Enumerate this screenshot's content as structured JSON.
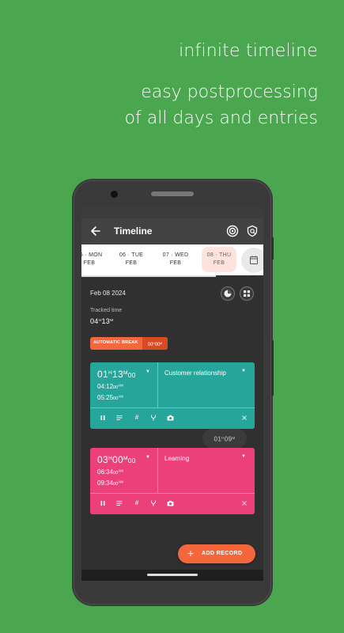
{
  "promo": {
    "title": "infinite timeline",
    "subtitle_line1": "easy postprocessing",
    "subtitle_line2": "of all days and entries"
  },
  "appbar": {
    "title": "Timeline",
    "icons": [
      "back-arrow-icon",
      "target-icon",
      "shield-badge-icon"
    ]
  },
  "days": [
    {
      "day": "05 · MON",
      "month": "FEB"
    },
    {
      "day": "06 · TUE",
      "month": "FEB"
    },
    {
      "day": "07 · WED",
      "month": "FEB"
    },
    {
      "day": "08 · THU",
      "month": "FEB",
      "selected": true
    }
  ],
  "summary": {
    "date": "Feb 08 2024",
    "tracked_label": "Tracked time",
    "tracked_h": "04",
    "tracked_h_unit": "H",
    "tracked_m": "13",
    "tracked_m_unit": "M"
  },
  "break_chip": {
    "label": "AUTOMATIC BREAK",
    "h": "00",
    "h_unit": "H",
    "m": "00",
    "m_unit": "M"
  },
  "entries": [
    {
      "duration_h": "01",
      "duration_m": "13",
      "seconds": "00",
      "start": "04:12",
      "start_ampm": "AM",
      "start_sec": "00",
      "end": "05:25",
      "end_ampm": "AM",
      "end_sec": "00",
      "category": "Customer relationship",
      "color": "#26a69a"
    },
    {
      "duration_h": "03",
      "duration_m": "00",
      "seconds": "00",
      "start": "06:34",
      "start_ampm": "AM",
      "start_sec": "00",
      "end": "09:34",
      "end_ampm": "AM",
      "end_sec": "00",
      "category": "Learning",
      "color": "#ec407a"
    }
  ],
  "gap": {
    "h": "01",
    "h_unit": "H",
    "m": "09",
    "m_unit": "M"
  },
  "units": {
    "h": "H",
    "m": "M"
  },
  "add_button": {
    "label": "ADD RECORD",
    "plus": "+"
  },
  "colors": {
    "background": "#4aa64f",
    "accent": "#f4663c",
    "teal": "#26a69a",
    "pink": "#ec407a"
  }
}
